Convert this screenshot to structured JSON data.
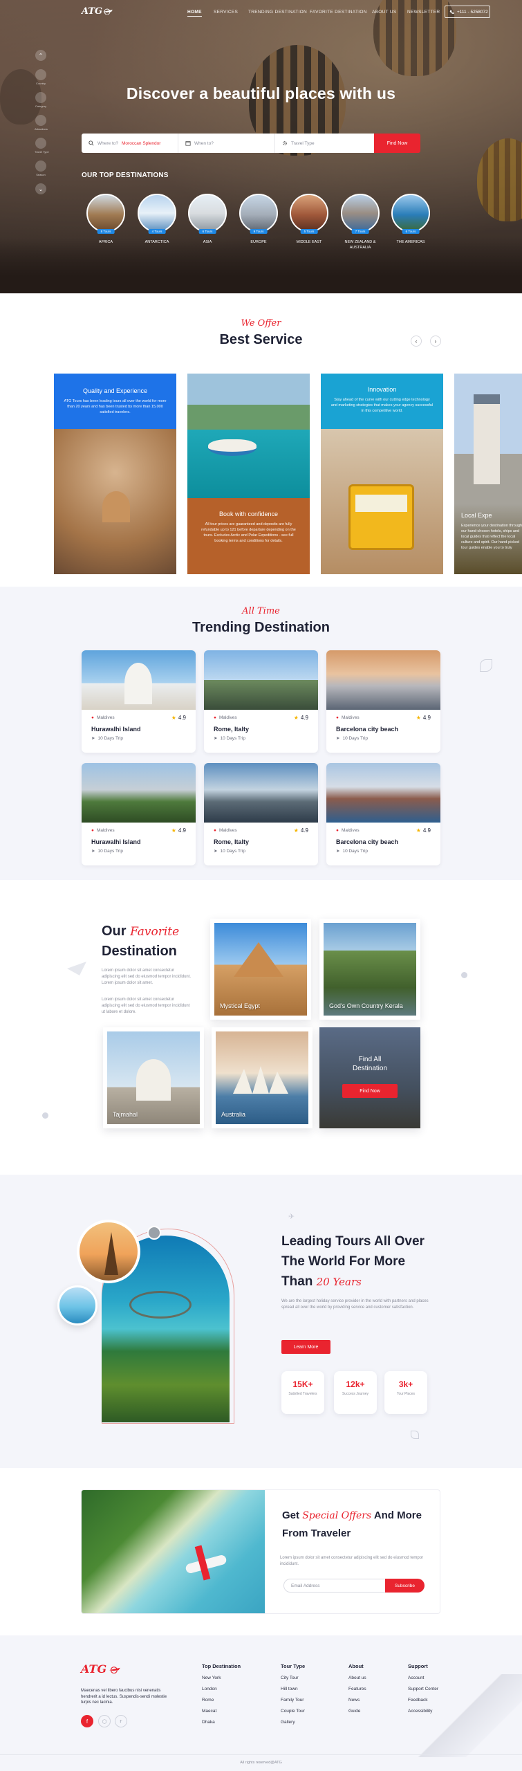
{
  "brand": {
    "logo": "ATG"
  },
  "nav": {
    "items": [
      "HOME",
      "SERVICES",
      "TRENDING DESTINATION",
      "FAVORITE DESTINATION",
      "ABOUT US",
      "NEWSLETTER"
    ],
    "phone": "+111 - 5258072"
  },
  "side_menu": [
    "Country",
    "Category",
    "Attractions",
    "Travel Type",
    "Season"
  ],
  "hero": {
    "title": "Discover a beautiful places with us",
    "search": {
      "where_label": "Where to?",
      "where_value": "Moroccan Splendor",
      "when_placeholder": "When to?",
      "type_placeholder": "Travel Type",
      "button": "Find Now"
    },
    "top_destinations_title": "OUR TOP DESTINATIONS",
    "destinations": [
      {
        "name": "AFRICA",
        "badge": "8 Tours"
      },
      {
        "name": "ANTARCTICA",
        "badge": "4 Tours"
      },
      {
        "name": "ASIA",
        "badge": "6 Tours"
      },
      {
        "name": "EUROPE",
        "badge": "9 Tours"
      },
      {
        "name": "MIDDLE EAST",
        "badge": "5 Tours"
      },
      {
        "name": "NEW ZEALAND & AUSTRALIA",
        "badge": "7 Tours"
      },
      {
        "name": "THE AMERICAS",
        "badge": "6 Tours"
      }
    ]
  },
  "offer": {
    "script": "We Offer",
    "title": "Best Service",
    "cards": [
      {
        "title": "Quality and Experience",
        "text": "ATG Tours has been leading tours all over the world for more than 20 years and has been trusted by more than 15,000 satisfied travelers."
      },
      {
        "title": "Book with confidence",
        "text": "All tour prices are guaranteed and deposits are fully refundable up to 121 before departure depending on the tours. Excludes Arctic and Polar Expeditions - see full booking terms and conditions for details."
      },
      {
        "title": "Innovation",
        "text": "Stay ahead of the curve with our cutting edge technology and marketing strategies that makes your agency successful in this competitive world."
      },
      {
        "title": "Local Expe",
        "text": "Experience your destination through our hand-chosen hotels, ships and local guides that reflect the local culture and spirit. Our hand-picked tour guides enable you to truly"
      }
    ]
  },
  "trending": {
    "script": "All Time",
    "title": "Trending Destination",
    "cards": [
      {
        "location": "Maldives",
        "rating": "4.9",
        "name": "Hurawalhi Island",
        "days": "10 Days Trip"
      },
      {
        "location": "Maldives",
        "rating": "4.9",
        "name": "Rome, Italty",
        "days": "10 Days Trip"
      },
      {
        "location": "Maldives",
        "rating": "4.9",
        "name": "Barcelona city beach",
        "days": "10 Days Trip"
      },
      {
        "location": "Maldives",
        "rating": "4.9",
        "name": "Hurawalhi Island",
        "days": "10 Days Trip"
      },
      {
        "location": "Maldives",
        "rating": "4.9",
        "name": "Rome, Italty",
        "days": "10 Days Trip"
      },
      {
        "location": "Maldives",
        "rating": "4.9",
        "name": "Barcelona city beach",
        "days": "10 Days Trip"
      }
    ]
  },
  "favorite": {
    "title_a": "Our",
    "title_script": "Favorite",
    "title_b": "Destination",
    "text1": "Lorem ipsum dolor sit amet consectetur adipiscing elit sed do eiusmod tempor incididunt. Lorem ipsum dolor sit amet.",
    "text2": "Lorem ipsum dolor sit amet consectetur adipiscing elit sed do eiusmod tempor incididunt ut labore et dolore.",
    "cards": [
      "Mystical Egypt",
      "God's Own Country Kerala",
      "Tajmahal",
      "Australia"
    ],
    "find_all": "Find All Destination",
    "find_btn": "Find Now"
  },
  "leading": {
    "line1": "Leading Tours All Over",
    "line2": "The World For More",
    "line3a": "Than",
    "line3_script": "20 Years",
    "text": "We are the largest holiday service provider in the world with partners and places spread all over the world by providing service and customer satisfaction.",
    "button": "Learn More",
    "stats": [
      {
        "num": "15K+",
        "label": "Satisfied Travelers"
      },
      {
        "num": "12k+",
        "label": "Success Journey"
      },
      {
        "num": "3k+",
        "label": "Tour Places"
      }
    ]
  },
  "special": {
    "title_a": "Get",
    "title_script": "Special Offers",
    "title_b": "And More",
    "title_c": "From Traveler",
    "text": "Lorem ipsum dolor sit amet consectetur adipiscing elit sed do eiusmod tempor incididunt.",
    "email_placeholder": "Email Address",
    "button": "Subscribe"
  },
  "footer": {
    "about_text": "Maecenas vel libero faucibus nisi venenatis hendrerit a id lectus. Suspendis-sendi molestie turpis nec lacinia.",
    "columns": [
      {
        "heading": "Top Destination",
        "items": [
          "New York",
          "London",
          "Rome",
          "Maecat",
          "Dhaka"
        ]
      },
      {
        "heading": "Tour Type",
        "items": [
          "City Tour",
          "Hill town",
          "Family Tour",
          "Couple Tour",
          "Gallery"
        ]
      },
      {
        "heading": "About",
        "items": [
          "About us",
          "Features",
          "News",
          "Guide"
        ]
      },
      {
        "heading": "Support",
        "items": [
          "Account",
          "Support Center",
          "Feedback",
          "Accessibility"
        ]
      }
    ],
    "copyright": "All rights reserved@ATG"
  },
  "colors": {
    "accent": "#e9242f",
    "dark": "#1f2235",
    "blue": "#1e88e5",
    "panel": "#f4f5fa"
  }
}
